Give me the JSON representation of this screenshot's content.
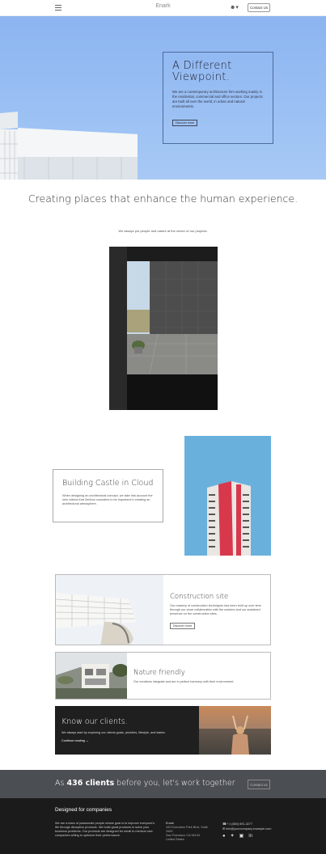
{
  "navbar": {
    "brand": "Enark",
    "contact_label": "Contact Us",
    "user_icon": "user-icon"
  },
  "hero": {
    "title": "A Different Viewpoint.",
    "text": "We are a contemporary architecture firm working mainly in the residential, commercial and office sectors. Our projects are built all over the world, in urban and natural environments.",
    "button": "Discover more"
  },
  "intro": {
    "heading": "Creating places that enhance the human experience.",
    "subtext": "We always put people and nature at the center of our projects."
  },
  "castle": {
    "title": "Building Castle in Cloud",
    "text": "When designing an architectural concept, we take into account the new criteria that Zenthor considers to be important in creating an architectural atmosphere."
  },
  "construction": {
    "title": "Construction site",
    "text": "Our mastery of construction techniques has been built up over time through our close collaboration with the workers and our sustained presence on the construction sites.",
    "button": "Discover more"
  },
  "nature": {
    "title": "Nature friendly",
    "text": "Our creations integrate and are in perfect harmony with their environment."
  },
  "clients": {
    "title": "Know our clients.",
    "text": "We always start by exploring our clients goals, priorities, lifestyle, and tastes.",
    "link": "Continue reading →"
  },
  "banner": {
    "prefix": "As ",
    "count": "436 clients",
    "suffix": " before you, let's work together",
    "button": "Contact us"
  },
  "footer": {
    "title": "Designed for companies",
    "text": "We are a team of passionate people whose goal is to improve everyone's life through disruptive products. We build great products to solve your business problems. Our products are designed for small to medium size companies willing to optimize their performance.",
    "address": [
      "Enark",
      "100 Executive Park Blvd, Suite 3400",
      "San Francisco CA 94134",
      "United States"
    ],
    "phone": "+1 (650) 691-3277",
    "email": "info@yourcompany.example.com",
    "social": [
      "github-icon",
      "twitter-icon",
      "instagram-icon",
      "linkedin-icon"
    ]
  }
}
